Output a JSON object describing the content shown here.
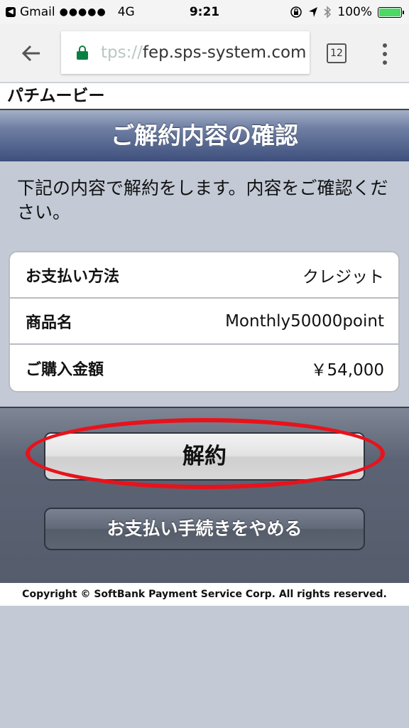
{
  "status_bar": {
    "back_app": "Gmail",
    "signal": "●●●●●",
    "network": "4G",
    "time": "9:21",
    "icons": [
      "orientation-lock-icon",
      "location-arrow-icon",
      "bluetooth-icon"
    ],
    "battery_text": "100%",
    "battery_level": 1.0,
    "battery_color": "#4cd964"
  },
  "browser": {
    "url_faded": "tps://",
    "url_main": "fep.sps-system.com",
    "tab_count": "12",
    "lock_color": "#0b8043"
  },
  "site": {
    "title": "パチムービー"
  },
  "page": {
    "header": "ご解約内容の確認",
    "instruction": "下記の内容で解約をします。内容をご確認ください。"
  },
  "details": [
    {
      "label": "お支払い方法",
      "value": "クレジット"
    },
    {
      "label": "商品名",
      "value": "Monthly50000point"
    },
    {
      "label": "ご購入金額",
      "value": "￥54,000"
    }
  ],
  "actions": {
    "cancel_label": "解約",
    "abort_label": "お支払い手続きをやめる"
  },
  "footer": {
    "copyright": "Copyright © SoftBank Payment Service Corp. All rights reserved."
  },
  "annotation_color": "#e8121b"
}
